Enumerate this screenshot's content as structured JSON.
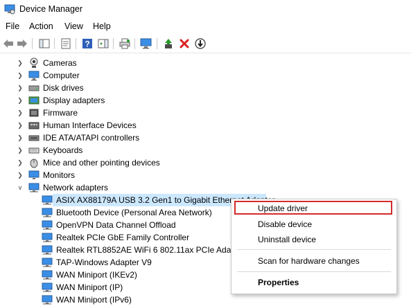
{
  "window": {
    "title": "Device Manager"
  },
  "menu": {
    "file": "File",
    "action": "Action",
    "view": "View",
    "help": "Help"
  },
  "tree": {
    "categories": [
      {
        "label": "Cameras",
        "icon": "camera-icon"
      },
      {
        "label": "Computer",
        "icon": "computer-icon"
      },
      {
        "label": "Disk drives",
        "icon": "disk-drive-icon"
      },
      {
        "label": "Display adapters",
        "icon": "display-adapter-icon"
      },
      {
        "label": "Firmware",
        "icon": "firmware-icon"
      },
      {
        "label": "Human Interface Devices",
        "icon": "hid-icon"
      },
      {
        "label": "IDE ATA/ATAPI controllers",
        "icon": "ide-controller-icon"
      },
      {
        "label": "Keyboards",
        "icon": "keyboard-icon"
      },
      {
        "label": "Mice and other pointing devices",
        "icon": "mouse-icon"
      },
      {
        "label": "Monitors",
        "icon": "monitor-icon"
      },
      {
        "label": "Network adapters",
        "icon": "network-adapter-icon"
      }
    ],
    "network_adapters": [
      "ASIX AX88179A USB 3.2 Gen1 to Gigabit Ethernet Adapter",
      "Bluetooth Device (Personal Area Network)",
      "OpenVPN Data Channel Offload",
      "Realtek PCIe GbE Family Controller",
      "Realtek RTL8852AE WiFi 6 802.11ax PCIe Adapter",
      "TAP-Windows Adapter V9",
      "WAN Miniport (IKEv2)",
      "WAN Miniport (IP)",
      "WAN Miniport (IPv6)"
    ]
  },
  "context_menu": {
    "update_driver": "Update driver",
    "disable_device": "Disable device",
    "uninstall_device": "Uninstall device",
    "scan": "Scan for hardware changes",
    "properties": "Properties"
  },
  "colors": {
    "selection": "#cce8ff",
    "highlight_border": "#d32a2a",
    "accent": "#1e7fd6"
  }
}
